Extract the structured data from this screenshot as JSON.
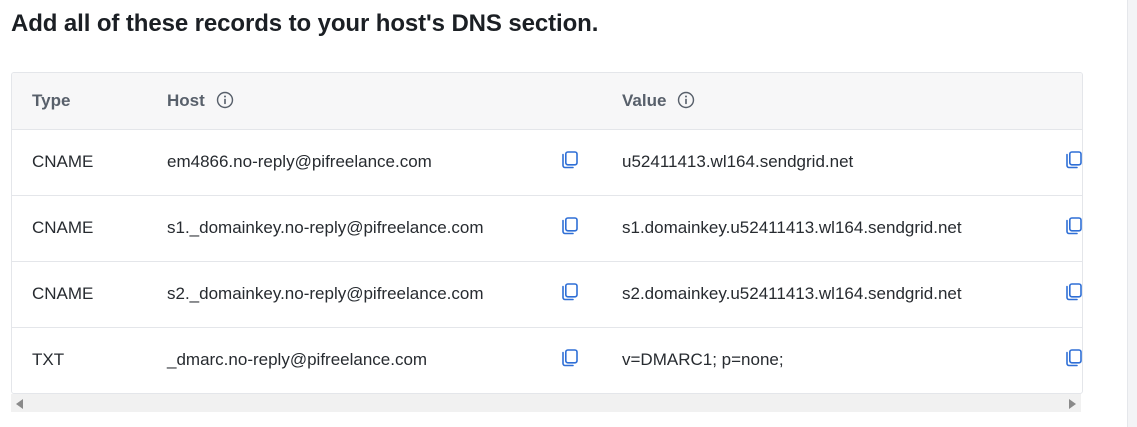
{
  "title": "Add all of these records to your host's DNS section.",
  "columns": {
    "type": "Type",
    "host": "Host",
    "value": "Value"
  },
  "icons": {
    "info": "info-icon",
    "copy": "copy-icon"
  },
  "accent_color": "#2f6fd6",
  "records": [
    {
      "type": "CNAME",
      "host": "em4866.no-reply@pifreelance.com",
      "value": "u52411413.wl164.sendgrid.net"
    },
    {
      "type": "CNAME",
      "host": "s1._domainkey.no-reply@pifreelance.com",
      "value": "s1.domainkey.u52411413.wl164.sendgrid.net"
    },
    {
      "type": "CNAME",
      "host": "s2._domainkey.no-reply@pifreelance.com",
      "value": "s2.domainkey.u52411413.wl164.sendgrid.net"
    },
    {
      "type": "TXT",
      "host": "_dmarc.no-reply@pifreelance.com",
      "value": "v=DMARC1; p=none;"
    }
  ]
}
